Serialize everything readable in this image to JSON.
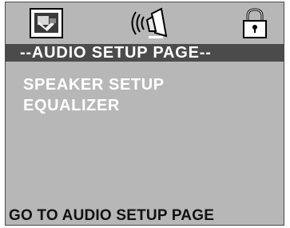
{
  "tabs": [
    {
      "id": "general",
      "icon": "general-setup-icon",
      "active": false
    },
    {
      "id": "audio",
      "icon": "speaker-audio-icon",
      "active": true
    },
    {
      "id": "lock",
      "icon": "padlock-icon",
      "active": false
    }
  ],
  "header": {
    "title": "--AUDIO  SETUP  PAGE--"
  },
  "menu": {
    "items": [
      {
        "label": "SPEAKER SETUP"
      },
      {
        "label": "EQUALIZER"
      }
    ]
  },
  "status": {
    "text": "GO TO AUDIO SETUP PAGE"
  },
  "colors": {
    "screen_bg": "#b7b7b7",
    "title_bar_bg": "#4b4b4b",
    "menu_text": "#ffffff",
    "status_text": "#111111"
  }
}
